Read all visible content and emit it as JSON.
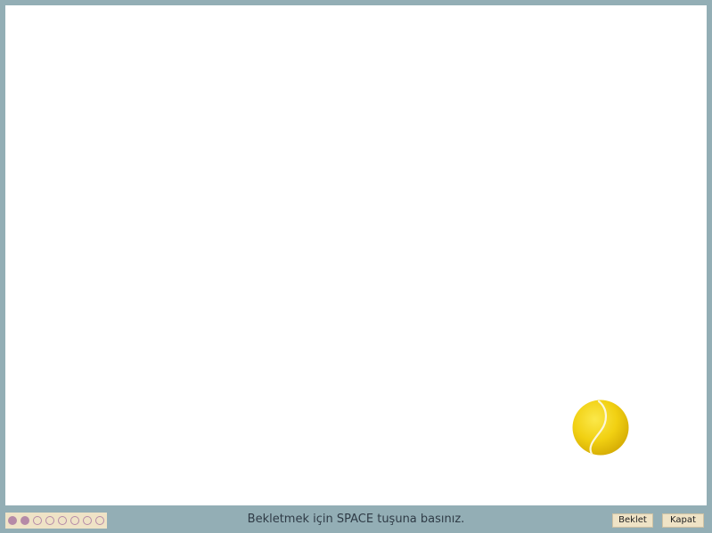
{
  "status": {
    "message": "Bekletmek için SPACE tuşuna basınız."
  },
  "progress": {
    "total_steps": 8,
    "completed_steps": 2
  },
  "buttons": {
    "pause_label": "Beklet",
    "close_label": "Kapat"
  },
  "colors": {
    "frame": "#93aeb5",
    "stage": "#ffffff",
    "progress_bg": "#efe3c6",
    "progress_dot": "#b58aa7",
    "ball": "#f3d60f"
  },
  "icons": {
    "ball": "tennis-ball-icon"
  }
}
